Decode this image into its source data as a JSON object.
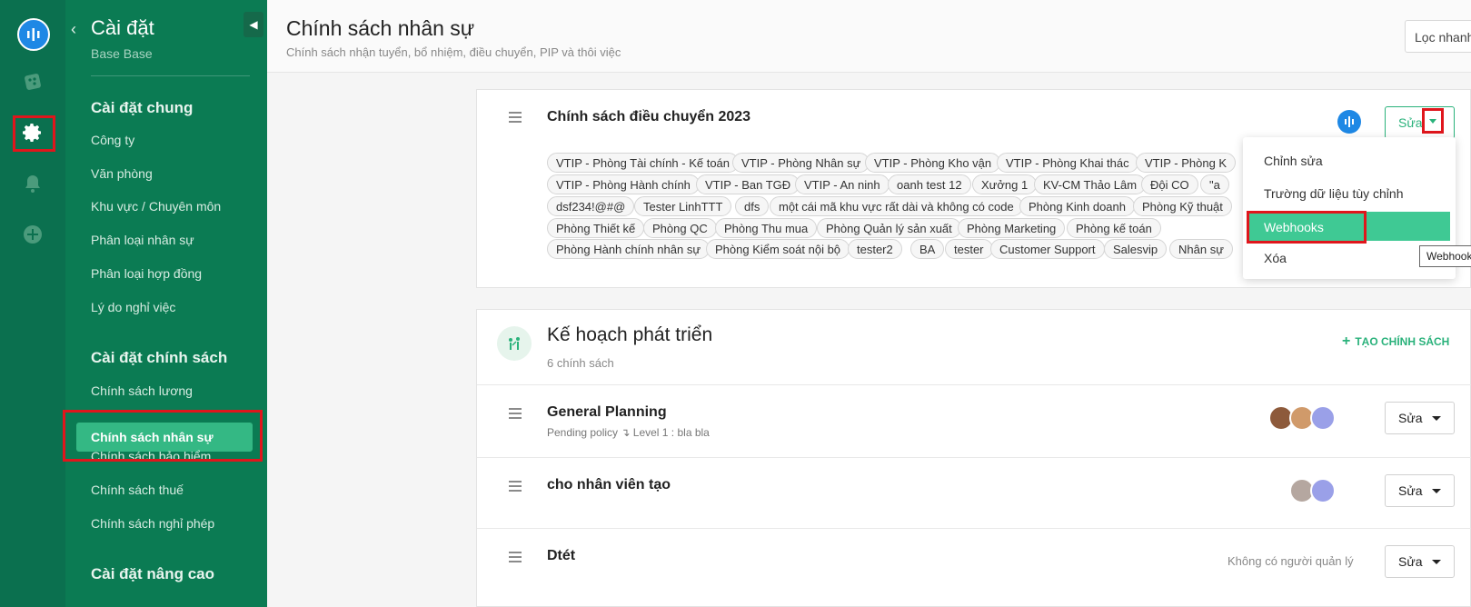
{
  "rail": {
    "icons": [
      "logo-icon",
      "dice-icon",
      "gear-icon",
      "bell-icon",
      "plus-circle-icon"
    ]
  },
  "sidebar": {
    "title": "Cài đặt",
    "subtitle": "Base Base",
    "sections": [
      {
        "label": "Cài đặt chung",
        "items": [
          "Công ty",
          "Văn phòng",
          "Khu vực / Chuyên môn",
          "Phân loại nhân sự",
          "Phân loại hợp đồng",
          "Lý do nghỉ việc"
        ]
      },
      {
        "label": "Cài đặt chính sách",
        "items": [
          "Chính sách lương",
          "Chính sách nhân sự",
          "Chính sách bảo hiểm",
          "Chính sách thuế",
          "Chính sách nghỉ phép"
        ]
      },
      {
        "label": "Cài đặt nâng cao",
        "items": []
      }
    ],
    "active_item": "Chính sách nhân sự"
  },
  "header": {
    "title": "Chính sách nhân sự",
    "subtitle": "Chính sách nhận tuyển, bổ nhiệm, điều chuyển, PIP và thôi việc",
    "filter_label": "Lọc nhanh"
  },
  "transfer_policy": {
    "title": "Chính sách điều chuyển 2023",
    "edit_label": "Sửa",
    "tags": [
      "VTIP - Phòng Tài chính - Kế toán",
      "VTIP - Phòng Nhân sự",
      "VTIP - Phòng Kho vận",
      "VTIP - Phòng Khai thác",
      "VTIP - Phòng K",
      "VTIP - Phòng Hành chính",
      "VTIP - Ban TGĐ",
      "VTIP - An ninh",
      "oanh test 12",
      "Xưởng 1",
      "KV-CM Thảo Lâm",
      "Đội CO",
      "\"a",
      "dsf234!@#@",
      "Tester LinhTTT",
      "dfs",
      "một cái mã khu vực rất dài và không có code",
      "Phòng Kinh doanh",
      "Phòng Kỹ thuật",
      "Phòng Thiết kế",
      "Phòng QC",
      "Phòng Thu mua",
      "Phòng Quản lý sản xuất",
      "Phòng Marketing",
      "Phòng kế toán",
      "Phòng Hành chính nhân sự",
      "Phòng Kiểm soát nội bộ",
      "tester2",
      "BA",
      "tester",
      "Customer Support",
      "Salesvip",
      "Nhân sự"
    ]
  },
  "dropdown": {
    "items": [
      "Chỉnh sửa",
      "Trường dữ liệu tùy chỉnh",
      "Webhooks",
      "Xóa"
    ],
    "active": "Webhooks",
    "tooltip": "Webhooks"
  },
  "development_plan": {
    "title": "Kế hoạch phát triển",
    "count": "6 chính sách",
    "create_label": "TẠO CHÍNH SÁCH",
    "policies": [
      {
        "title": "General Planning",
        "sub": "Pending policy ↴ Level 1 : bla bla",
        "edit": "Sửa"
      },
      {
        "title": "cho nhân viên tạo",
        "sub": "",
        "edit": "Sửa"
      },
      {
        "title": "Dtét",
        "sub": "",
        "manager": "Không có người quản lý",
        "edit": "Sửa"
      }
    ]
  },
  "colors": {
    "rail": "#0b704f",
    "sidebar": "#0b7b53",
    "accent": "#2ab27b",
    "highlight": "#e0161c",
    "menu_active": "#3fc994"
  }
}
